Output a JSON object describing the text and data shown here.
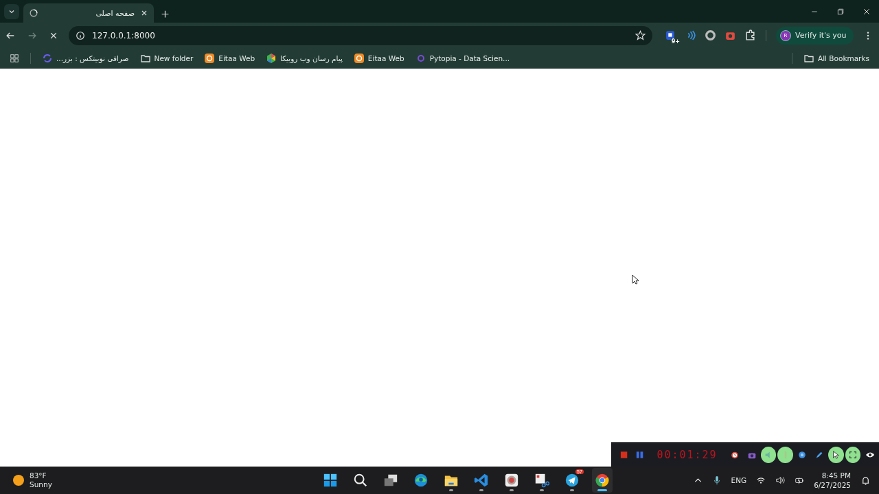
{
  "tab": {
    "title": "صفحه اصلی",
    "loading": true
  },
  "toolbar": {
    "url": "127.0.0.1:8000",
    "extensions": [
      {
        "kind": "notify",
        "badge": "9+"
      },
      {
        "kind": "waves"
      },
      {
        "kind": "ring"
      },
      {
        "kind": "camera"
      },
      {
        "kind": "puzzle"
      }
    ],
    "profile": {
      "initial": "R",
      "label": "Verify it's you"
    }
  },
  "bookmarks": [
    {
      "kind": "swirl",
      "label": "صرافی نوبیتکس : بزر..."
    },
    {
      "kind": "folder",
      "label": "New folder"
    },
    {
      "kind": "eitaa",
      "label": "Eitaa Web"
    },
    {
      "kind": "rubika",
      "label": "پیام رسان وب روبیکا"
    },
    {
      "kind": "eitaa",
      "label": "Eitaa Web"
    },
    {
      "kind": "dot",
      "label": "Pytopia - Data Scien..."
    }
  ],
  "all_bookmarks": "All Bookmarks",
  "recorder": {
    "timer": "00:01:29",
    "tools": [
      {
        "kind": "clock",
        "on": false
      },
      {
        "kind": "camera",
        "on": false
      },
      {
        "kind": "speaker",
        "on": true
      },
      {
        "kind": "mic",
        "on": true
      },
      {
        "kind": "webcam",
        "on": false
      },
      {
        "kind": "pen",
        "on": false
      },
      {
        "kind": "cursor",
        "on": true
      },
      {
        "kind": "fullscreen",
        "on": true
      },
      {
        "kind": "eye",
        "on": false
      }
    ]
  },
  "taskbar": {
    "weather": {
      "temp": "83°F",
      "condition": "Sunny"
    },
    "apps": [
      {
        "kind": "start",
        "running": false,
        "selected": false
      },
      {
        "kind": "search",
        "running": false,
        "selected": false
      },
      {
        "kind": "taskview",
        "running": false,
        "selected": false
      },
      {
        "kind": "edge",
        "running": false,
        "selected": false
      },
      {
        "kind": "files",
        "running": true,
        "selected": false
      },
      {
        "kind": "vscode",
        "running": true,
        "selected": false
      },
      {
        "kind": "app",
        "running": true,
        "selected": false
      },
      {
        "kind": "snip",
        "running": true,
        "selected": false
      },
      {
        "kind": "telegram",
        "running": true,
        "selected": false,
        "badge": "57"
      },
      {
        "kind": "chrome",
        "running": true,
        "selected": true
      }
    ],
    "language": "ENG",
    "time": "8:45 PM",
    "date": "6/27/2025"
  }
}
